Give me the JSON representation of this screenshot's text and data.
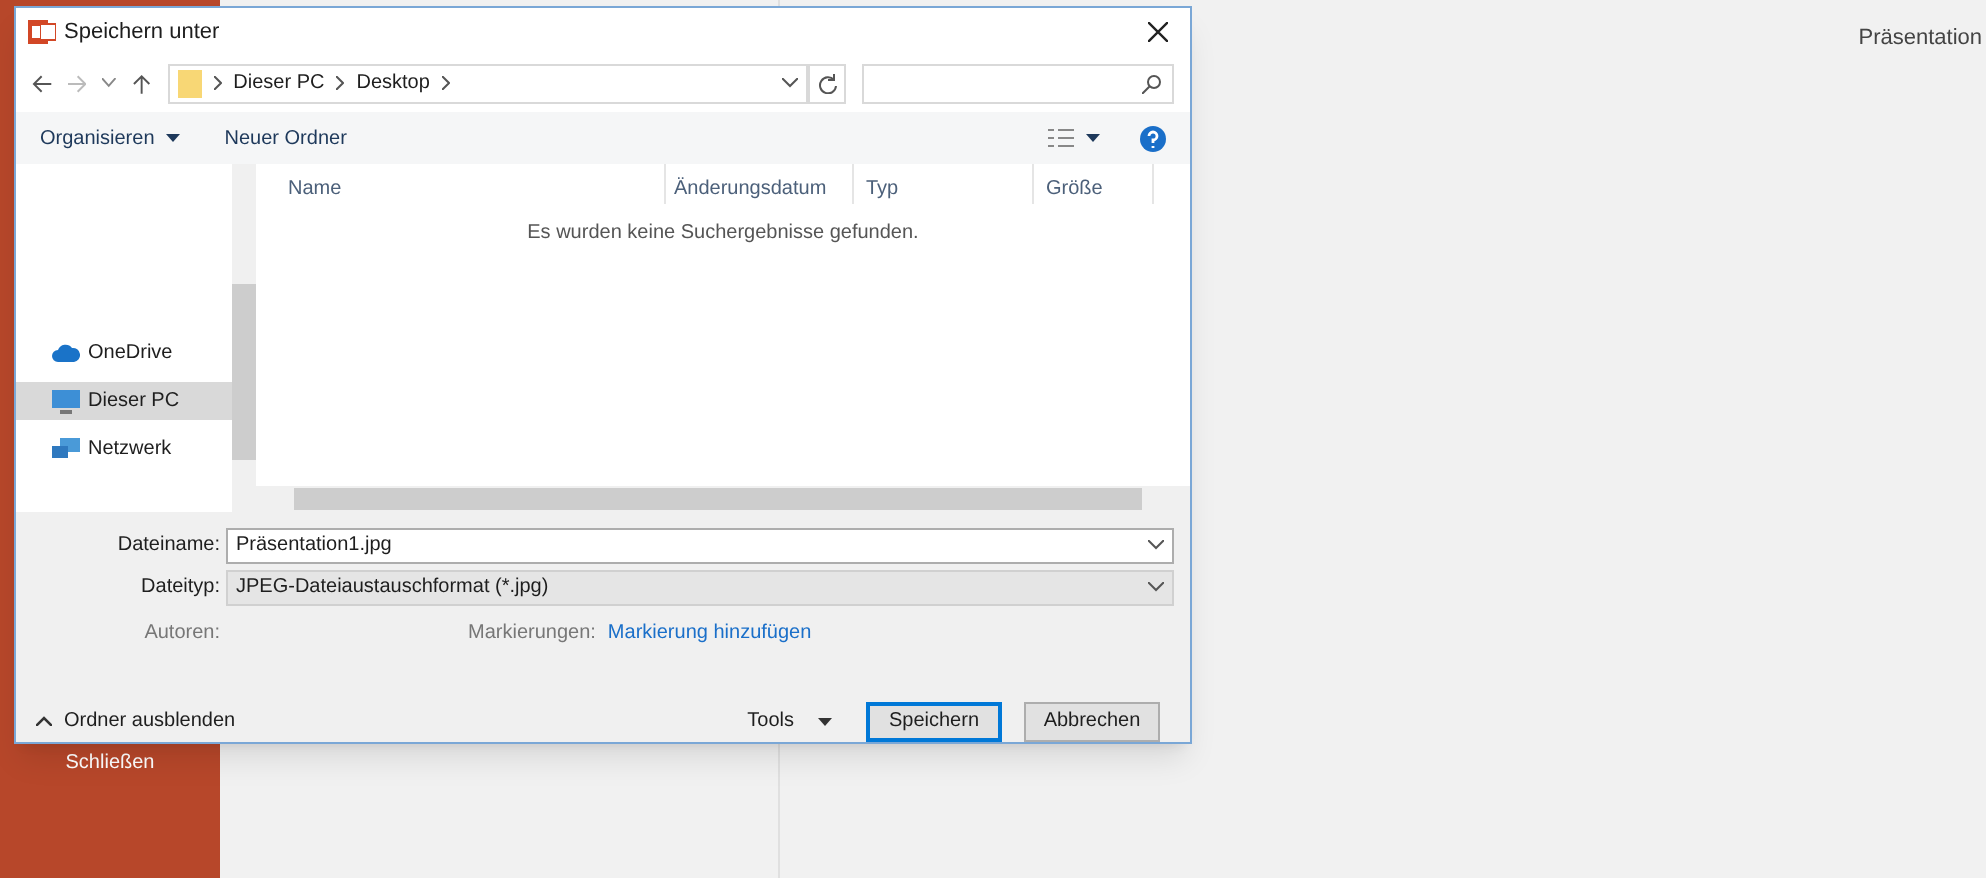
{
  "backstage": {
    "sidebar_items": [
      {
        "label": "Schließen"
      }
    ],
    "document_title": "Präsentation"
  },
  "dialog": {
    "title": "Speichern unter",
    "breadcrumbs": [
      "Dieser PC",
      "Desktop"
    ],
    "toolbar": {
      "organize": "Organisieren",
      "new_folder": "Neuer Ordner"
    },
    "nav_items": [
      {
        "label": "OneDrive",
        "kind": "cloud",
        "selected": false
      },
      {
        "label": "Dieser PC",
        "kind": "pc",
        "selected": true
      },
      {
        "label": "Netzwerk",
        "kind": "network",
        "selected": false
      }
    ],
    "columns": [
      "Name",
      "Änderungsdatum",
      "Typ",
      "Größe"
    ],
    "empty_message": "Es wurden keine Suchergebnisse gefunden.",
    "filename": {
      "label": "Dateiname:",
      "value": "Präsentation1.jpg"
    },
    "filetype": {
      "label": "Dateityp:",
      "value": "JPEG-Dateiaustauschformat (*.jpg)"
    },
    "authors": {
      "label": "Autoren:"
    },
    "tags": {
      "label": "Markierungen:",
      "link": "Markierung hinzufügen"
    },
    "hide_folders": "Ordner ausblenden",
    "tools": "Tools",
    "buttons": [
      {
        "label": "Speichern",
        "kind": "primary"
      },
      {
        "label": "Abbrechen",
        "kind": "normal"
      }
    ]
  }
}
